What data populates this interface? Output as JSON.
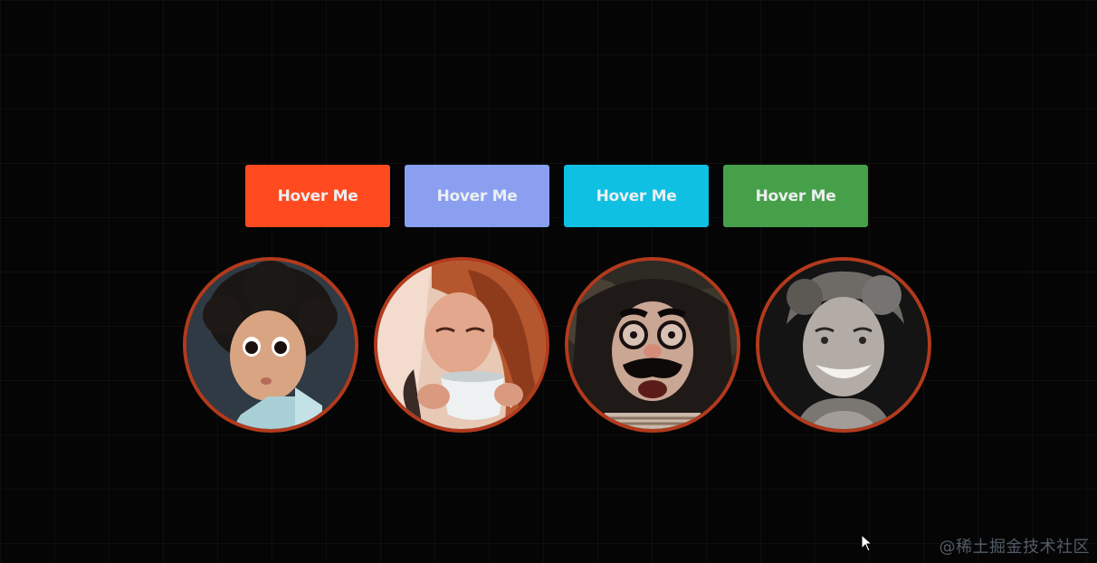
{
  "buttons": [
    {
      "label": "Hover Me",
      "color": "#ff4a1f"
    },
    {
      "label": "Hover Me",
      "color": "#8a9ff0"
    },
    {
      "label": "Hover Me",
      "color": "#0fc0e2"
    },
    {
      "label": "Hover Me",
      "color": "#46a04a"
    }
  ],
  "avatars": [
    {
      "subject": "child-with-curly-hair"
    },
    {
      "subject": "woman-drinking-coffee"
    },
    {
      "subject": "person-with-funny-glasses-disguise"
    },
    {
      "subject": "smiling-young-man"
    }
  ],
  "avatar_border_color": "#b23a1c",
  "watermark": "@稀土掘金技术社区"
}
